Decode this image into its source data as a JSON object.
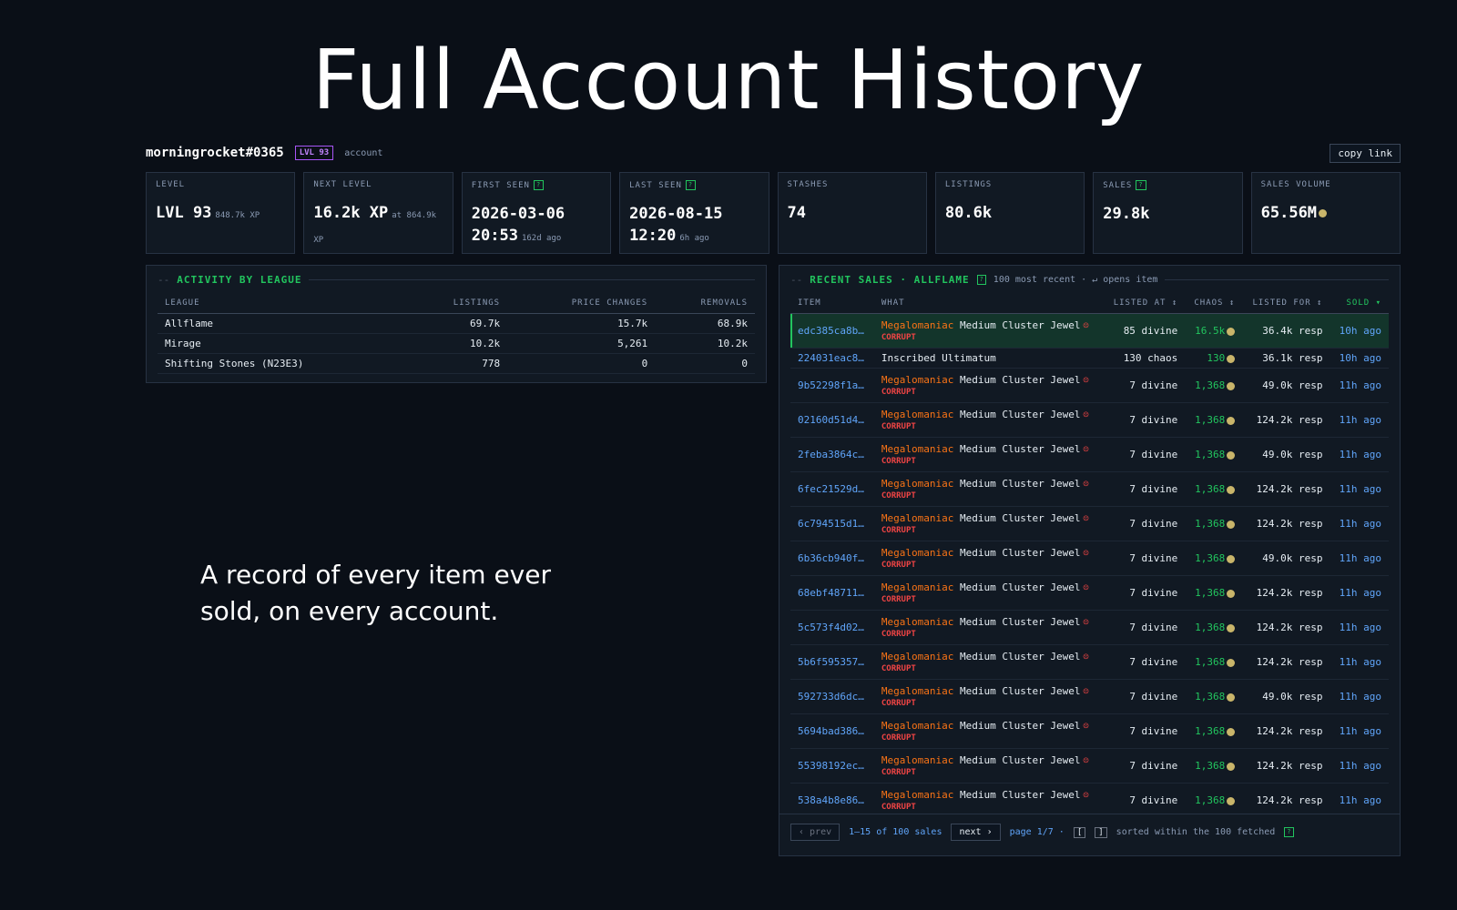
{
  "hero": {
    "title": "Full Account History",
    "tagline": "A record of every item ever sold, on every account."
  },
  "account": {
    "name": "morningrocket#0365",
    "level_badge": "LVL 93",
    "tag": "account",
    "copy_label": "copy link"
  },
  "stats": [
    {
      "label": "LEVEL",
      "help": false,
      "value": "LVL 93",
      "sub": "848.7k XP",
      "coin": false
    },
    {
      "label": "NEXT LEVEL",
      "help": false,
      "value": "16.2k XP",
      "sub": "at 864.9k XP",
      "coin": false
    },
    {
      "label": "FIRST SEEN",
      "help": true,
      "value": "2026-03-06 20:53",
      "sub": "162d ago",
      "coin": false
    },
    {
      "label": "LAST SEEN",
      "help": true,
      "value": "2026-08-15 12:20",
      "sub": "6h ago",
      "coin": false
    },
    {
      "label": "STASHES",
      "help": false,
      "value": "74",
      "sub": "",
      "coin": false
    },
    {
      "label": "LISTINGS",
      "help": false,
      "value": "80.6k",
      "sub": "",
      "coin": false
    },
    {
      "label": "SALES",
      "help": true,
      "value": "29.8k",
      "sub": "",
      "coin": false
    },
    {
      "label": "SALES VOLUME",
      "help": false,
      "value": "65.56M",
      "sub": "",
      "coin": true
    }
  ],
  "league_panel": {
    "title": "ACTIVITY BY LEAGUE",
    "columns": [
      "LEAGUE",
      "LISTINGS",
      "PRICE CHANGES",
      "REMOVALS"
    ],
    "rows": [
      [
        "Allflame",
        "69.7k",
        "15.7k",
        "68.9k"
      ],
      [
        "Mirage",
        "10.2k",
        "5,261",
        "10.2k"
      ],
      [
        "Shifting Stones (N23E3)",
        "778",
        "0",
        "0"
      ]
    ]
  },
  "sales_panel": {
    "title": "RECENT SALES · ALLFLAME",
    "note": "100 most recent · ↵ opens item",
    "help_mark": "?",
    "columns": [
      "ITEM",
      "WHAT",
      "LISTED AT ↕",
      "CHAOS ↕",
      "LISTED FOR ↕",
      "SOLD ▾"
    ],
    "rows": [
      {
        "id": "edc385ca8b…",
        "prefix": "Megalomaniac",
        "name": "Medium Cluster Jewel",
        "corrupt": true,
        "listed_at": "85 divine",
        "chaos": "16.5k",
        "listed_for": "36.4k resp",
        "sold": "10h ago",
        "highlight": true
      },
      {
        "id": "224031eac8…",
        "prefix": "",
        "name": "Inscribed Ultimatum",
        "corrupt": false,
        "listed_at": "130 chaos",
        "chaos": "130",
        "listed_for": "36.1k resp",
        "sold": "10h ago",
        "highlight": false
      },
      {
        "id": "9b52298f1a…",
        "prefix": "Megalomaniac",
        "name": "Medium Cluster Jewel",
        "corrupt": true,
        "listed_at": "7 divine",
        "chaos": "1,368",
        "listed_for": "49.0k resp",
        "sold": "11h ago",
        "highlight": false
      },
      {
        "id": "02160d51d4…",
        "prefix": "Megalomaniac",
        "name": "Medium Cluster Jewel",
        "corrupt": true,
        "listed_at": "7 divine",
        "chaos": "1,368",
        "listed_for": "124.2k resp",
        "sold": "11h ago",
        "highlight": false
      },
      {
        "id": "2feba3864c…",
        "prefix": "Megalomaniac",
        "name": "Medium Cluster Jewel",
        "corrupt": true,
        "listed_at": "7 divine",
        "chaos": "1,368",
        "listed_for": "49.0k resp",
        "sold": "11h ago",
        "highlight": false
      },
      {
        "id": "6fec21529d…",
        "prefix": "Megalomaniac",
        "name": "Medium Cluster Jewel",
        "corrupt": true,
        "listed_at": "7 divine",
        "chaos": "1,368",
        "listed_for": "124.2k resp",
        "sold": "11h ago",
        "highlight": false
      },
      {
        "id": "6c794515d1…",
        "prefix": "Megalomaniac",
        "name": "Medium Cluster Jewel",
        "corrupt": true,
        "listed_at": "7 divine",
        "chaos": "1,368",
        "listed_for": "124.2k resp",
        "sold": "11h ago",
        "highlight": false
      },
      {
        "id": "6b36cb940f…",
        "prefix": "Megalomaniac",
        "name": "Medium Cluster Jewel",
        "corrupt": true,
        "listed_at": "7 divine",
        "chaos": "1,368",
        "listed_for": "49.0k resp",
        "sold": "11h ago",
        "highlight": false
      },
      {
        "id": "68ebf48711…",
        "prefix": "Megalomaniac",
        "name": "Medium Cluster Jewel",
        "corrupt": true,
        "listed_at": "7 divine",
        "chaos": "1,368",
        "listed_for": "124.2k resp",
        "sold": "11h ago",
        "highlight": false
      },
      {
        "id": "5c573f4d02…",
        "prefix": "Megalomaniac",
        "name": "Medium Cluster Jewel",
        "corrupt": true,
        "listed_at": "7 divine",
        "chaos": "1,368",
        "listed_for": "124.2k resp",
        "sold": "11h ago",
        "highlight": false
      },
      {
        "id": "5b6f595357…",
        "prefix": "Megalomaniac",
        "name": "Medium Cluster Jewel",
        "corrupt": true,
        "listed_at": "7 divine",
        "chaos": "1,368",
        "listed_for": "124.2k resp",
        "sold": "11h ago",
        "highlight": false
      },
      {
        "id": "592733d6dc…",
        "prefix": "Megalomaniac",
        "name": "Medium Cluster Jewel",
        "corrupt": true,
        "listed_at": "7 divine",
        "chaos": "1,368",
        "listed_for": "49.0k resp",
        "sold": "11h ago",
        "highlight": false
      },
      {
        "id": "5694bad386…",
        "prefix": "Megalomaniac",
        "name": "Medium Cluster Jewel",
        "corrupt": true,
        "listed_at": "7 divine",
        "chaos": "1,368",
        "listed_for": "124.2k resp",
        "sold": "11h ago",
        "highlight": false
      },
      {
        "id": "55398192ec…",
        "prefix": "Megalomaniac",
        "name": "Medium Cluster Jewel",
        "corrupt": true,
        "listed_at": "7 divine",
        "chaos": "1,368",
        "listed_for": "124.2k resp",
        "sold": "11h ago",
        "highlight": false
      },
      {
        "id": "538a4b8e86…",
        "prefix": "Megalomaniac",
        "name": "Medium Cluster Jewel",
        "corrupt": true,
        "listed_at": "7 divine",
        "chaos": "1,368",
        "listed_for": "124.2k resp",
        "sold": "11h ago",
        "highlight": false
      }
    ],
    "corrupt_label": "CORRUPT",
    "pager": {
      "prev": "‹ prev",
      "range": "1–15 of 100 sales",
      "next": "next ›",
      "page": "page 1/7 ·",
      "key_prev": "[",
      "key_next": "]",
      "sort_note": "sorted within the 100 fetched"
    }
  },
  "colors": {
    "background": "#0a0f17",
    "accent_green": "#22c55e",
    "link_blue": "#60a5fa",
    "corrupt_red": "#ef4444",
    "prefix_orange": "#f97316",
    "badge_purple": "#a855f7"
  }
}
